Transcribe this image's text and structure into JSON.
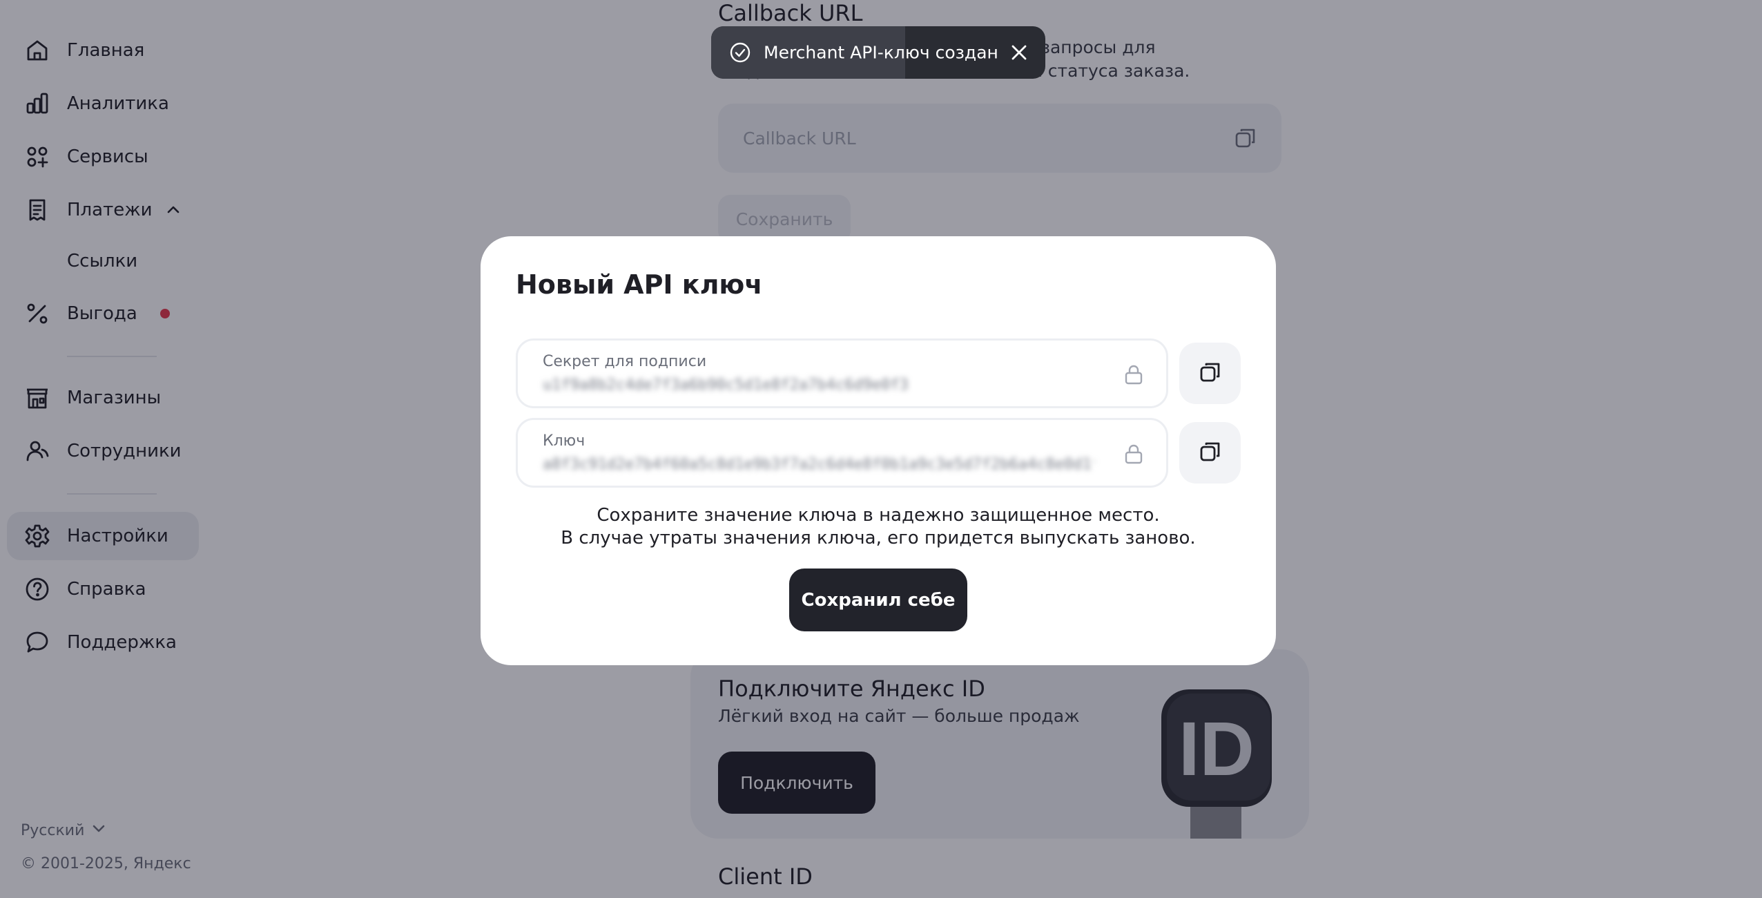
{
  "sidebar": {
    "items": [
      {
        "label": "Главная",
        "icon": "home-icon"
      },
      {
        "label": "Аналитика",
        "icon": "analytics-icon"
      },
      {
        "label": "Сервисы",
        "icon": "services-icon"
      },
      {
        "label": "Платежи",
        "icon": "payments-icon",
        "expanded": true
      },
      {
        "label": "Ссылки"
      },
      {
        "label": "Выгода",
        "icon": "percent-icon",
        "badge_color": "#e6384b"
      },
      {
        "label": "Магазины",
        "icon": "store-icon"
      },
      {
        "label": "Сотрудники",
        "icon": "employees-icon"
      },
      {
        "label": "Настройки",
        "icon": "gear-icon",
        "active": true
      },
      {
        "label": "Справка",
        "icon": "help-icon"
      },
      {
        "label": "Поддержка",
        "icon": "chat-icon"
      }
    ],
    "language": "Русский",
    "copyright": "© 2001-2025, Яндекс"
  },
  "main": {
    "callback": {
      "title": "Callback URL",
      "description": "На этот адрес будут отправляться запросы для создания, обновления и изменения статуса заказа.",
      "placeholder": "Callback URL",
      "save_label": "Сохранить"
    },
    "promo": {
      "title": "Подключите Яндекс ID",
      "subtitle": "Лёгкий вход на сайт — больше продаж",
      "button": "Подключить"
    },
    "client_id_title": "Client ID"
  },
  "toast": {
    "text": "Merchant API-ключ создан",
    "progress": 0.58
  },
  "modal": {
    "title": "Новый API ключ",
    "fields": [
      {
        "label": "Секрет для подписи",
        "value": "u1f9a8b2c4de7f3a6b90c5d1e8f2a7b4c6d9e0f3"
      },
      {
        "label": "Ключ",
        "value": "a8f3c91d2e7b4f60a5c8d1e9b3f7a2c6d4e8f0b1a9c3e5d7f2b6a4c8e0d1f9b3a7"
      }
    ],
    "note_line1": "Сохраните значение ключа в надежно защищенное место.",
    "note_line2": "В случае утраты значения ключа, его придется выпускать заново.",
    "confirm_label": "Сохранил себе"
  },
  "colors": {
    "accent_dark": "#1f1f26",
    "overlay": "rgba(18,20,38,0.42)",
    "badge": "#e6384b"
  }
}
